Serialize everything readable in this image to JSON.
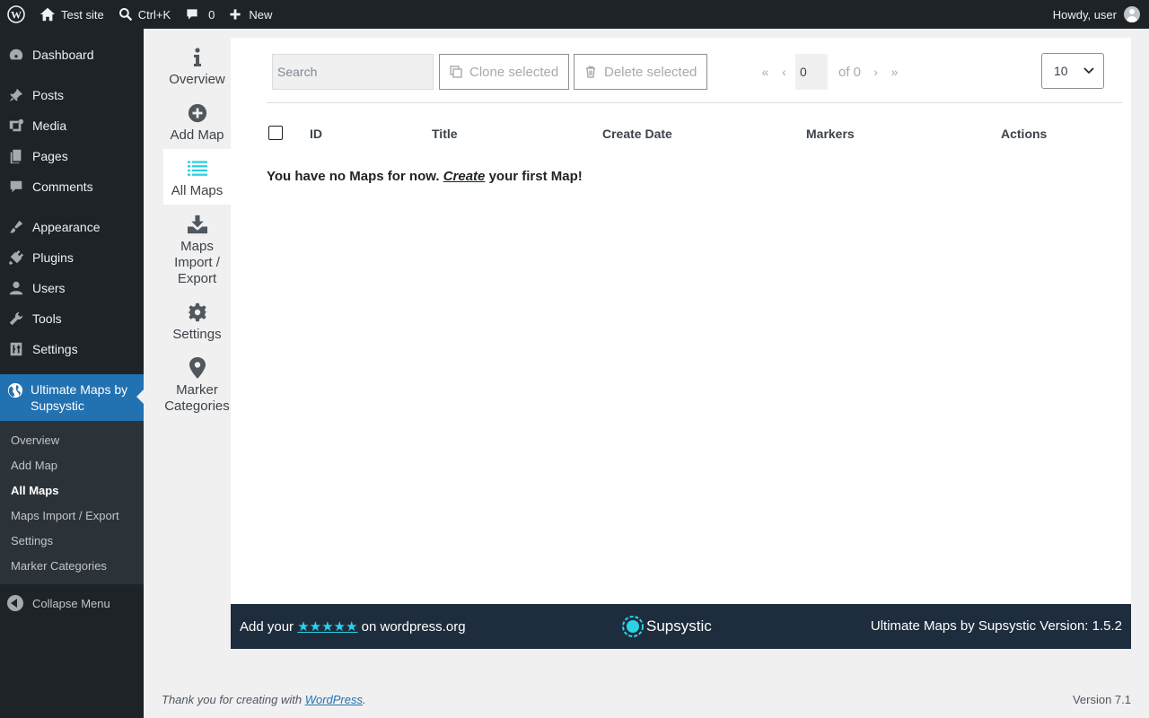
{
  "adminbar": {
    "site_name": "Test site",
    "search_shortcut": "Ctrl+K",
    "comments_count": "0",
    "new_label": "New",
    "greeting": "Howdy, user"
  },
  "menu": {
    "items": [
      {
        "label": "Dashboard",
        "icon": "dashboard-icon"
      },
      {
        "label": "Posts",
        "icon": "pin-icon"
      },
      {
        "label": "Media",
        "icon": "media-icon"
      },
      {
        "label": "Pages",
        "icon": "pages-icon"
      },
      {
        "label": "Comments",
        "icon": "comment-icon"
      },
      {
        "label": "Appearance",
        "icon": "brush-icon"
      },
      {
        "label": "Plugins",
        "icon": "plug-icon"
      },
      {
        "label": "Users",
        "icon": "user-icon"
      },
      {
        "label": "Tools",
        "icon": "wrench-icon"
      },
      {
        "label": "Settings",
        "icon": "sliders-icon"
      }
    ],
    "current": {
      "label": "Ultimate Maps by Supsystic",
      "icon": "globe-icon"
    },
    "submenu": [
      "Overview",
      "Add Map",
      "All Maps",
      "Maps Import / Export",
      "Settings",
      "Marker Categories"
    ],
    "submenu_current": "All Maps",
    "collapse_label": "Collapse Menu"
  },
  "plugin_nav": {
    "overview": "Overview",
    "add_map": "Add Map",
    "all_maps": "All Maps",
    "import_export": "Maps Import / Export",
    "settings": "Settings",
    "marker_categories": "Marker Categories"
  },
  "toolbar": {
    "search_placeholder": "Search",
    "clone_label": "Clone selected",
    "delete_label": "Delete selected",
    "page_value": "0",
    "page_of": "of 0",
    "per_page": "10"
  },
  "table": {
    "columns": [
      "ID",
      "Title",
      "Create Date",
      "Markers",
      "Actions"
    ],
    "empty_prefix": "You have no Maps for now.",
    "empty_link": "Create",
    "empty_suffix": "your first Map!"
  },
  "footer_bar": {
    "rate_prefix": "Add your",
    "stars": "★★★★★",
    "rate_suffix": "on wordpress.org",
    "brand": "Supsystic",
    "version_text": "Ultimate Maps by Supsystic Version: 1.5.2"
  },
  "wp_footer": {
    "thanks_prefix": "Thank you for creating with",
    "thanks_link": "WordPress",
    "version": "Version 7.1"
  },
  "colors": {
    "accent": "#2271b1",
    "plugin_accent": "#2bd2e6",
    "footer_bar_bg": "#1e2d3d"
  }
}
